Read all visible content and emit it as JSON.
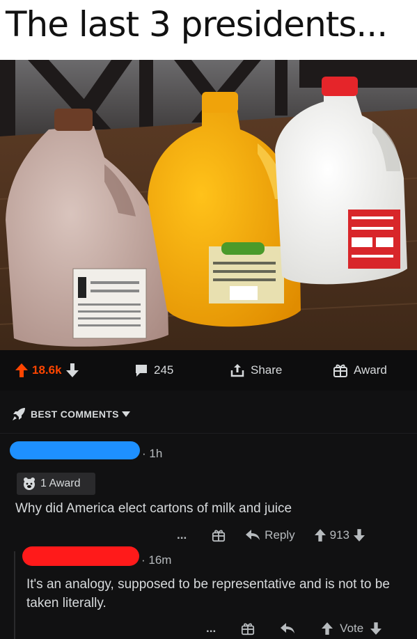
{
  "meme": {
    "caption": "The last 3 presidents..."
  },
  "post_actions": {
    "score": "18.6k",
    "comment_count": "245",
    "share_label": "Share",
    "award_label": "Award"
  },
  "comments_header": {
    "sort_label": "BEST COMMENTS"
  },
  "comments": [
    {
      "age": "1h",
      "award_badge": "1 Award",
      "text": "Why did America elect cartons of milk and juice",
      "more": "...",
      "reply_label": "Reply",
      "score": "913"
    },
    {
      "age": "16m",
      "text": "It's an analogy, supposed to be representative and is not to be taken literally.",
      "more": "...",
      "vote_label": "Vote"
    }
  ],
  "colors": {
    "upvote": "#ff4500",
    "redaction_1": "#1e90ff",
    "redaction_2": "#ff1a1a",
    "background": "#111112"
  },
  "icons": [
    "upvote-arrow-icon",
    "downvote-arrow-icon",
    "comment-bubble-icon",
    "share-icon",
    "gift-icon",
    "rocket-icon",
    "chevron-down-icon",
    "bear-award-icon",
    "reply-arrow-icon"
  ]
}
